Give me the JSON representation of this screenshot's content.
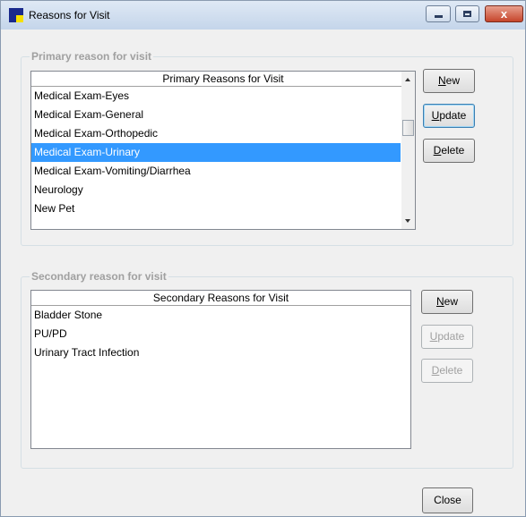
{
  "window": {
    "title": "Reasons for Visit",
    "icon": "app-icon",
    "controls": {
      "minimize": "minimize-icon",
      "maximize": "maximize-icon",
      "close": "x"
    }
  },
  "primary": {
    "legend": "Primary reason for visit",
    "header": "Primary Reasons for Visit",
    "items": [
      "Medical Exam-Eyes",
      "Medical Exam-General",
      "Medical Exam-Orthopedic",
      "Medical Exam-Urinary",
      "Medical Exam-Vomiting/Diarrhea",
      "Neurology",
      "New Pet"
    ],
    "selected_index": 3,
    "buttons": {
      "new": {
        "accel": "N",
        "rest": "ew"
      },
      "update": {
        "accel": "U",
        "rest": "pdate"
      },
      "delete": {
        "accel": "D",
        "rest": "elete"
      }
    }
  },
  "secondary": {
    "legend": "Secondary reason for visit",
    "header": "Secondary Reasons for Visit",
    "items": [
      "Bladder Stone",
      "PU/PD",
      "Urinary Tract Infection"
    ],
    "buttons": {
      "new": {
        "accel": "N",
        "rest": "ew"
      },
      "update": {
        "accel": "U",
        "rest": "pdate"
      },
      "delete": {
        "accel": "D",
        "rest": "elete"
      }
    }
  },
  "close_label": "Close",
  "colors": {
    "selection": "#3399ff",
    "legend_text": "#a0a0a0"
  }
}
